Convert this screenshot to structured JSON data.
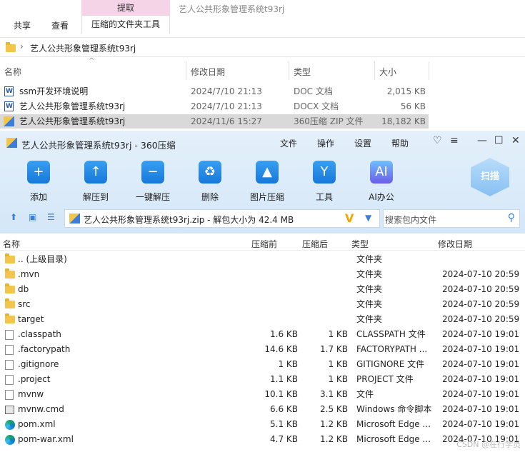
{
  "explorer": {
    "ribbon": {
      "context_tab": "提取",
      "title": "艺人公共形象管理系统t93rj",
      "tabs": [
        "共享",
        "查看"
      ],
      "context_sub": "压缩的文件夹工具"
    },
    "address": "艺人公共形象管理系统t93rj",
    "columns": [
      "名称",
      "修改日期",
      "类型",
      "大小"
    ],
    "files": [
      {
        "name": "ssm开发环境说明",
        "date": "2024/7/10 21:13",
        "type": "DOC 文档",
        "size": "2,015 KB"
      },
      {
        "name": "艺人公共形象管理系统t93rj",
        "date": "2024/7/10 21:13",
        "type": "DOCX 文档",
        "size": "56 KB"
      },
      {
        "name": "艺人公共形象管理系统t93rj",
        "date": "2024/11/6 15:27",
        "type": "360压缩 ZIP 文件",
        "size": "18,182 KB"
      }
    ]
  },
  "zip": {
    "title": "艺人公共形象管理系统t93rj - 360压缩",
    "menu": [
      "文件",
      "操作",
      "设置",
      "帮助"
    ],
    "toolbar": [
      "添加",
      "解压到",
      "一键解压",
      "删除",
      "图片压缩",
      "工具",
      "AI办公"
    ],
    "scan_label": "扫描",
    "path_text": "艺人公共形象管理系统t93rj.zip - 解包大小为 42.4 MB",
    "search_placeholder": "搜索包内文件",
    "columns": [
      "名称",
      "压缩前",
      "压缩后",
      "类型",
      "修改日期"
    ],
    "rows": [
      {
        "icon": "folder",
        "name": ".. (上级目录)",
        "before": "",
        "after": "",
        "type": "文件夹",
        "date": ""
      },
      {
        "icon": "folder",
        "name": ".mvn",
        "before": "",
        "after": "",
        "type": "文件夹",
        "date": "2024-07-10 20:59"
      },
      {
        "icon": "folder",
        "name": "db",
        "before": "",
        "after": "",
        "type": "文件夹",
        "date": "2024-07-10 20:59"
      },
      {
        "icon": "folder",
        "name": "src",
        "before": "",
        "after": "",
        "type": "文件夹",
        "date": "2024-07-10 20:59"
      },
      {
        "icon": "folder",
        "name": "target",
        "before": "",
        "after": "",
        "type": "文件夹",
        "date": "2024-07-10 20:59"
      },
      {
        "icon": "doc",
        "name": ".classpath",
        "before": "1.6 KB",
        "after": "1 KB",
        "type": "CLASSPATH 文件",
        "date": "2024-07-10 19:01"
      },
      {
        "icon": "doc",
        "name": ".factorypath",
        "before": "14.6 KB",
        "after": "1.7 KB",
        "type": "FACTORYPATH ...",
        "date": "2024-07-10 19:01"
      },
      {
        "icon": "doc",
        "name": ".gitignore",
        "before": "1 KB",
        "after": "1 KB",
        "type": "GITIGNORE 文件",
        "date": "2024-07-10 19:01"
      },
      {
        "icon": "doc",
        "name": ".project",
        "before": "1.1 KB",
        "after": "1 KB",
        "type": "PROJECT 文件",
        "date": "2024-07-10 19:01"
      },
      {
        "icon": "doc",
        "name": "mvnw",
        "before": "10.1 KB",
        "after": "3.1 KB",
        "type": "文件",
        "date": "2024-07-10 19:01"
      },
      {
        "icon": "cmd",
        "name": "mvnw.cmd",
        "before": "6.6 KB",
        "after": "2.5 KB",
        "type": "Windows 命令脚本",
        "date": "2024-07-10 19:01"
      },
      {
        "icon": "edge",
        "name": "pom.xml",
        "before": "5.1 KB",
        "after": "1.2 KB",
        "type": "Microsoft Edge ...",
        "date": "2024-07-10 19:01"
      },
      {
        "icon": "edge",
        "name": "pom-war.xml",
        "before": "4.7 KB",
        "after": "1.2 KB",
        "type": "Microsoft Edge ...",
        "date": "2024-07-10 19:01"
      }
    ],
    "watermark": "CSDN @在行学员"
  }
}
